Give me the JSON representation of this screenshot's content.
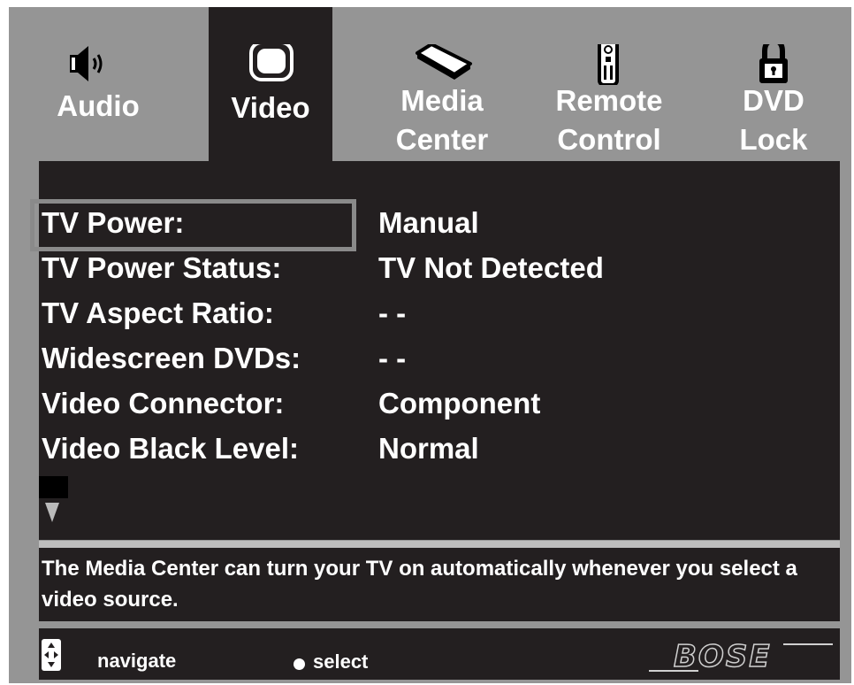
{
  "tabs": {
    "audio": {
      "label": "Audio",
      "icon": "speaker-icon"
    },
    "video": {
      "label": "Video",
      "icon": "tv-icon",
      "active": true
    },
    "media_center": {
      "line1": "Media",
      "line2": "Center",
      "icon": "media-center-icon"
    },
    "remote_control": {
      "line1": "Remote",
      "line2": "Control",
      "icon": "remote-icon"
    },
    "dvd_lock": {
      "line1": "DVD",
      "line2": "Lock",
      "icon": "lock-icon"
    }
  },
  "settings": [
    {
      "label": "TV Power:",
      "value": "Manual"
    },
    {
      "label": "TV Power Status:",
      "value": "TV Not Detected"
    },
    {
      "label": "TV Aspect Ratio:",
      "value": "- -"
    },
    {
      "label": "Widescreen DVDs:",
      "value": "- -"
    },
    {
      "label": "Video Connector:",
      "value": "Component"
    },
    {
      "label": "Video Black Level:",
      "value": "Normal"
    }
  ],
  "help_text": "The Media Center can turn your TV on automatically whenever you select a video source.",
  "footer": {
    "navigate_label": "navigate",
    "select_label": "select",
    "brand": "BOSE"
  },
  "colors": {
    "frame": "#959595",
    "panel": "#231f20",
    "selection_border": "#8a8a8a",
    "text": "#ffffff"
  }
}
